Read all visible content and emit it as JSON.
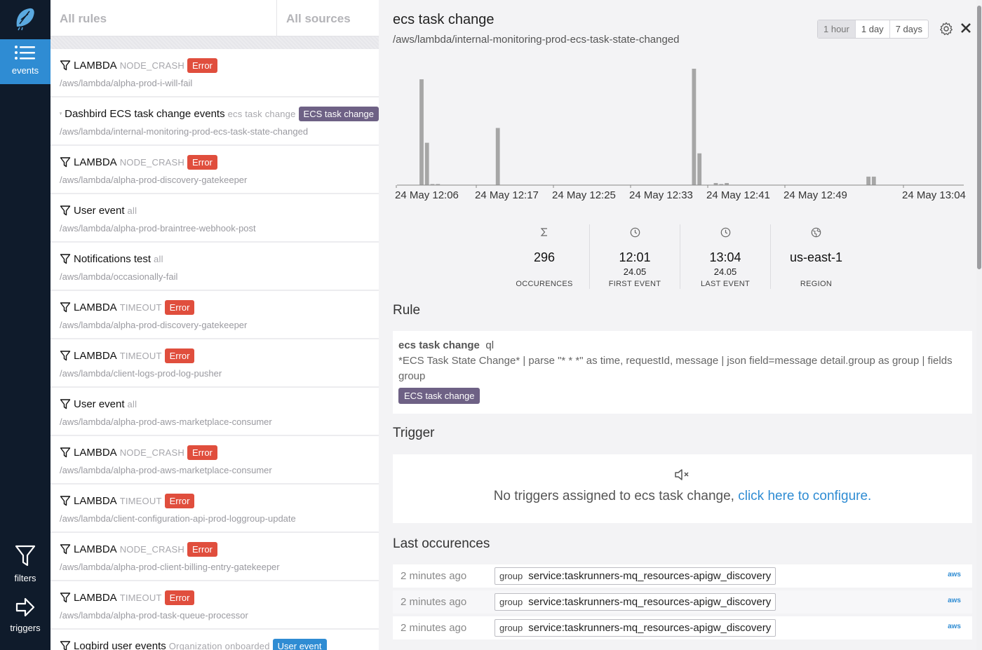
{
  "nav": {
    "events_label": "events",
    "filters_label": "filters",
    "triggers_label": "triggers"
  },
  "list": {
    "tabs": [
      "All rules",
      "All sources"
    ],
    "items": [
      {
        "title": "LAMBDA",
        "sub": "NODE_CRASH",
        "badge": "Error",
        "badge_color": "#e04e3d",
        "path": "/aws/lambda/alpha-prod-i-will-fail"
      },
      {
        "title": "Dashbird ECS task change events",
        "sub": "ecs task change",
        "badge": "ECS task change",
        "badge_color": "#6e6185",
        "path": "/aws/lambda/internal-monitoring-prod-ecs-task-state-changed"
      },
      {
        "title": "LAMBDA",
        "sub": "NODE_CRASH",
        "badge": "Error",
        "badge_color": "#e04e3d",
        "path": "/aws/lambda/alpha-prod-discovery-gatekeeper"
      },
      {
        "title": "User event",
        "sub": "all",
        "badge": "",
        "badge_color": "",
        "path": "/aws/lambda/alpha-prod-braintree-webhook-post"
      },
      {
        "title": "Notifications test",
        "sub": "all",
        "badge": "",
        "badge_color": "",
        "path": "/aws/lambda/occasionally-fail"
      },
      {
        "title": "LAMBDA",
        "sub": "TIMEOUT",
        "badge": "Error",
        "badge_color": "#e04e3d",
        "path": "/aws/lambda/alpha-prod-discovery-gatekeeper"
      },
      {
        "title": "LAMBDA",
        "sub": "TIMEOUT",
        "badge": "Error",
        "badge_color": "#e04e3d",
        "path": "/aws/lambda/client-logs-prod-log-pusher"
      },
      {
        "title": "User event",
        "sub": "all",
        "badge": "",
        "badge_color": "",
        "path": "/aws/lambda/alpha-prod-aws-marketplace-consumer"
      },
      {
        "title": "LAMBDA",
        "sub": "NODE_CRASH",
        "badge": "Error",
        "badge_color": "#e04e3d",
        "path": "/aws/lambda/alpha-prod-aws-marketplace-consumer"
      },
      {
        "title": "LAMBDA",
        "sub": "TIMEOUT",
        "badge": "Error",
        "badge_color": "#e04e3d",
        "path": "/aws/lambda/client-configuration-api-prod-loggroup-update"
      },
      {
        "title": "LAMBDA",
        "sub": "NODE_CRASH",
        "badge": "Error",
        "badge_color": "#e04e3d",
        "path": "/aws/lambda/alpha-prod-client-billing-entry-gatekeeper"
      },
      {
        "title": "LAMBDA",
        "sub": "TIMEOUT",
        "badge": "Error",
        "badge_color": "#e04e3d",
        "path": "/aws/lambda/alpha-prod-task-queue-processor"
      },
      {
        "title": "Logbird user events",
        "sub": "Organization onboarded",
        "badge": "User event",
        "badge_color": "#2f8cd3",
        "path": ""
      }
    ]
  },
  "detail": {
    "title": "ecs task change",
    "subtitle": "/aws/lambda/internal-monitoring-prod-ecs-task-state-changed",
    "ranges": [
      "1 hour",
      "1 day",
      "7 days"
    ],
    "active_range": "1 hour",
    "stats": [
      {
        "icon": "sigma-icon",
        "value": "296",
        "value2": "",
        "caption": "OCCURENCES"
      },
      {
        "icon": "clock-icon",
        "value": "12:01",
        "value2": "24.05",
        "caption": "FIRST EVENT"
      },
      {
        "icon": "clock-icon",
        "value": "13:04",
        "value2": "24.05",
        "caption": "LAST EVENT"
      },
      {
        "icon": "globe-icon",
        "value": "us-east-1",
        "value2": "",
        "caption": "REGION"
      }
    ],
    "rule_heading": "Rule",
    "rule": {
      "name": "ecs task change",
      "type": "ql",
      "query": "*ECS Task State Change* | parse \"* * *\" as time, requestId, message | json field=message detail.group as group | fields group",
      "tag": "ECS task change"
    },
    "trigger_heading": "Trigger",
    "trigger": {
      "text": "No triggers assigned to ecs task change,",
      "link": "click here to configure."
    },
    "occ_heading": "Last occurences",
    "occurrences": [
      {
        "ago": "2 minutes ago",
        "key": "group",
        "value": "service:taskrunners-mq_resources-apigw_discovery",
        "source": "aws"
      },
      {
        "ago": "2 minutes ago",
        "key": "group",
        "value": "service:taskrunners-mq_resources-apigw_discovery",
        "source": "aws"
      },
      {
        "ago": "2 minutes ago",
        "key": "group",
        "value": "service:taskrunners-mq_resources-apigw_discovery",
        "source": "aws"
      }
    ]
  },
  "chart_data": {
    "type": "bar",
    "x_tick_labels": [
      "24 May 12:06",
      "24 May 12:17",
      "24 May 12:25",
      "24 May 12:33",
      "24 May 12:41",
      "24 May 12:49",
      "24 May 13:04"
    ],
    "bar_color": "#a6a6a6",
    "values": [
      0,
      0,
      0,
      0,
      100,
      40,
      1,
      1,
      0,
      0,
      0,
      0,
      0,
      0,
      0,
      0,
      0,
      0,
      54,
      0,
      0,
      0,
      0,
      0,
      0,
      0,
      0,
      0,
      0,
      0,
      0,
      0,
      0,
      0,
      0,
      0,
      0,
      0,
      0,
      0,
      0,
      0,
      0,
      0,
      0,
      0,
      0,
      0,
      0,
      0,
      0,
      0,
      0,
      0,
      110,
      30,
      0,
      0,
      2,
      1,
      2,
      0,
      0,
      0,
      0,
      0,
      0,
      0,
      0,
      0,
      0,
      0,
      0,
      0,
      0,
      0,
      0,
      0,
      0,
      0,
      0,
      0,
      0,
      0,
      0,
      0,
      8,
      8,
      0,
      0,
      0,
      0,
      0,
      0,
      0,
      0,
      0,
      0,
      0,
      0,
      0,
      0,
      0,
      0
    ],
    "xlabel": "",
    "ylabel": ""
  }
}
